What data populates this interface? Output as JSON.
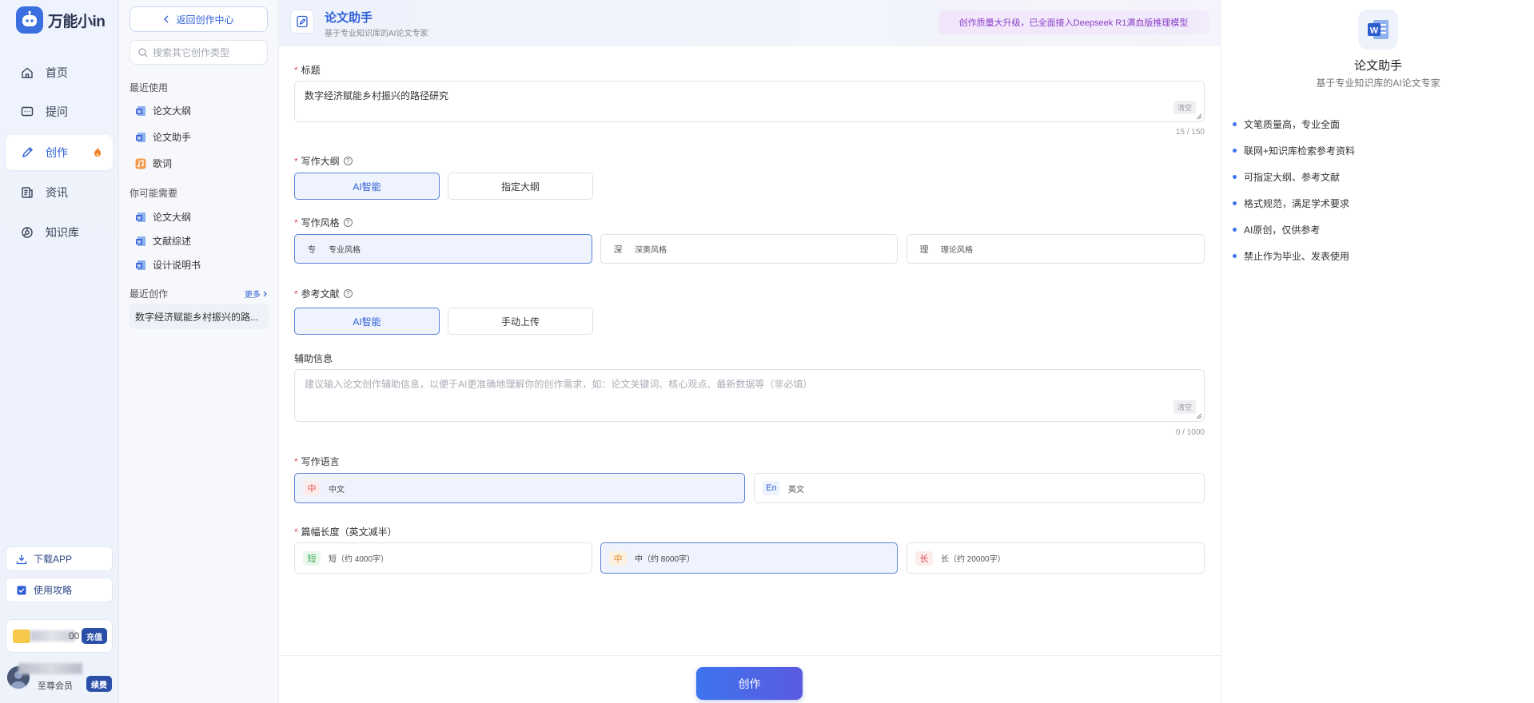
{
  "app": {
    "logo_text": "万能小in"
  },
  "nav": {
    "items": [
      {
        "label": "首页",
        "icon": "home-icon"
      },
      {
        "label": "提问",
        "icon": "chat-icon"
      },
      {
        "label": "创作",
        "icon": "pen-icon",
        "active": true
      },
      {
        "label": "资讯",
        "icon": "news-icon"
      },
      {
        "label": "知识库",
        "icon": "knowledge-icon"
      }
    ],
    "download_app": "下载APP",
    "guide": "使用攻略",
    "wallet_digits": "00",
    "recharge": "充值",
    "member_label": "至尊会员",
    "renew": "续费"
  },
  "side": {
    "back": "返回创作中心",
    "search_placeholder": "搜索其它创作类型",
    "recent_title": "最近使用",
    "recent": [
      "论文大纲",
      "论文助手",
      "歌词"
    ],
    "maybe_title": "你可能需要",
    "maybe": [
      "论文大纲",
      "文献综述",
      "设计说明书"
    ],
    "recent_creation_title": "最近创作",
    "more": "更多",
    "recent_creation": "数字经济赋能乡村振兴的路..."
  },
  "header": {
    "title": "论文助手",
    "subtitle": "基于专业知识库的AI论文专家",
    "banner": "创作质量大升级，已全面接入Deepseek R1满血版推理模型"
  },
  "form": {
    "title_label": "标题",
    "title_value": "数字经济赋能乡村振兴的路径研究",
    "clear": "清空",
    "title_counter": "15 / 150",
    "outline_label": "写作大纲",
    "outline_options": [
      "AI智能",
      "指定大纲"
    ],
    "style_label": "写作风格",
    "style_options": [
      {
        "tag": "专",
        "label": "专业风格"
      },
      {
        "tag": "深",
        "label": "深奥风格"
      },
      {
        "tag": "理",
        "label": "理论风格"
      }
    ],
    "ref_label": "参考文献",
    "ref_options": [
      "AI智能",
      "手动上传"
    ],
    "aux_label": "辅助信息",
    "aux_placeholder": "建议输入论文创作辅助信息，以便于AI更准确地理解你的创作需求，如：论文关键词、核心观点、最新数据等（非必填）",
    "aux_counter": "0 / 1000",
    "lang_label": "写作语言",
    "lang_options": [
      {
        "tag": "中",
        "label": "中文"
      },
      {
        "tag": "En",
        "label": "英文"
      }
    ],
    "length_label": "篇幅长度（英文减半）",
    "length_options": [
      {
        "tag": "短",
        "label": "短（约 4000字）"
      },
      {
        "tag": "中",
        "label": "中（约 8000字）"
      },
      {
        "tag": "长",
        "label": "长（约 20000字）"
      }
    ],
    "submit": "创作"
  },
  "right": {
    "title": "论文助手",
    "subtitle": "基于专业知识库的AI论文专家",
    "features": [
      "文笔质量高，专业全面",
      "联网+知识库检索参考资料",
      "可指定大纲、参考文献",
      "格式规范，满足学术要求",
      "AI原创，仅供参考",
      "禁止作为毕业、发表使用"
    ]
  },
  "colors": {
    "accent": "#2f5fd6",
    "banner_text": "#8a3fc8",
    "required": "#e04d4d"
  }
}
